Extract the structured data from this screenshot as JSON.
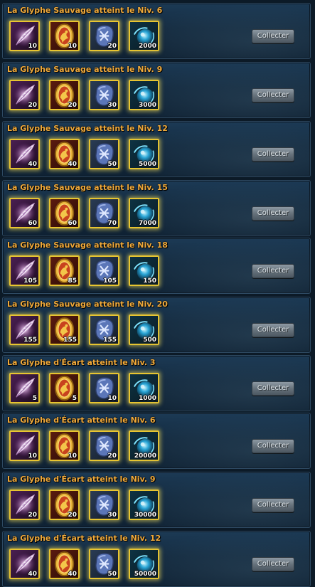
{
  "button_label": "Collecter",
  "colors": {
    "title": "#f0a93a",
    "slot_border": "#e8c530",
    "panel": "#17304a"
  },
  "rows": [
    {
      "title": "La Glyphe Sauvage atteint le Niv. 6",
      "rewards": [
        {
          "icon": "feather-icon",
          "qty": "10"
        },
        {
          "icon": "gold-token-icon",
          "qty": "10"
        },
        {
          "icon": "blue-rune-stone-icon",
          "qty": "20"
        },
        {
          "icon": "blue-orb-icon",
          "qty": "2000"
        }
      ]
    },
    {
      "title": "La Glyphe Sauvage atteint le Niv. 9",
      "rewards": [
        {
          "icon": "feather-icon",
          "qty": "20"
        },
        {
          "icon": "gold-token-icon",
          "qty": "20"
        },
        {
          "icon": "blue-rune-stone-icon",
          "qty": "30"
        },
        {
          "icon": "blue-orb-icon",
          "qty": "3000"
        }
      ]
    },
    {
      "title": "La Glyphe Sauvage atteint le Niv. 12",
      "rewards": [
        {
          "icon": "feather-icon",
          "qty": "40"
        },
        {
          "icon": "gold-token-icon",
          "qty": "40"
        },
        {
          "icon": "blue-rune-stone-icon",
          "qty": "50"
        },
        {
          "icon": "blue-orb-icon",
          "qty": "5000"
        }
      ]
    },
    {
      "title": "La Glyphe Sauvage atteint le Niv. 15",
      "rewards": [
        {
          "icon": "feather-icon",
          "qty": "60"
        },
        {
          "icon": "gold-token-icon",
          "qty": "60"
        },
        {
          "icon": "blue-rune-stone-icon",
          "qty": "70"
        },
        {
          "icon": "blue-orb-icon",
          "qty": "7000"
        }
      ]
    },
    {
      "title": "La Glyphe Sauvage atteint le Niv. 18",
      "rewards": [
        {
          "icon": "feather-icon",
          "qty": "105"
        },
        {
          "icon": "gold-token-icon",
          "qty": "85"
        },
        {
          "icon": "blue-rune-stone-icon",
          "qty": "105"
        },
        {
          "icon": "blue-orb-icon",
          "qty": "150"
        }
      ]
    },
    {
      "title": "La Glyphe Sauvage atteint le Niv. 20",
      "rewards": [
        {
          "icon": "feather-icon",
          "qty": "155"
        },
        {
          "icon": "gold-token-icon",
          "qty": "155"
        },
        {
          "icon": "blue-rune-stone-icon",
          "qty": "155"
        },
        {
          "icon": "blue-orb-icon",
          "qty": "500"
        }
      ]
    },
    {
      "title": "La Glyphe d'Écart atteint le Niv. 3",
      "rewards": [
        {
          "icon": "feather-icon",
          "qty": "5"
        },
        {
          "icon": "gold-token-icon",
          "qty": "5"
        },
        {
          "icon": "blue-rune-stone-icon",
          "qty": "10"
        },
        {
          "icon": "blue-orb-icon",
          "qty": "1000"
        }
      ]
    },
    {
      "title": "La Glyphe d'Écart atteint le Niv. 6",
      "rewards": [
        {
          "icon": "feather-icon",
          "qty": "10"
        },
        {
          "icon": "gold-token-icon",
          "qty": "10"
        },
        {
          "icon": "blue-rune-stone-icon",
          "qty": "20"
        },
        {
          "icon": "blue-orb-icon",
          "qty": "20000"
        }
      ]
    },
    {
      "title": "La Glyphe d'Écart atteint le Niv. 9",
      "rewards": [
        {
          "icon": "feather-icon",
          "qty": "20"
        },
        {
          "icon": "gold-token-icon",
          "qty": "20"
        },
        {
          "icon": "blue-rune-stone-icon",
          "qty": "30"
        },
        {
          "icon": "blue-orb-icon",
          "qty": "30000"
        }
      ]
    },
    {
      "title": "La Glyphe d'Écart atteint le Niv. 12",
      "rewards": [
        {
          "icon": "feather-icon",
          "qty": "40"
        },
        {
          "icon": "gold-token-icon",
          "qty": "40"
        },
        {
          "icon": "blue-rune-stone-icon",
          "qty": "50"
        },
        {
          "icon": "blue-orb-icon",
          "qty": "50000"
        }
      ]
    }
  ]
}
